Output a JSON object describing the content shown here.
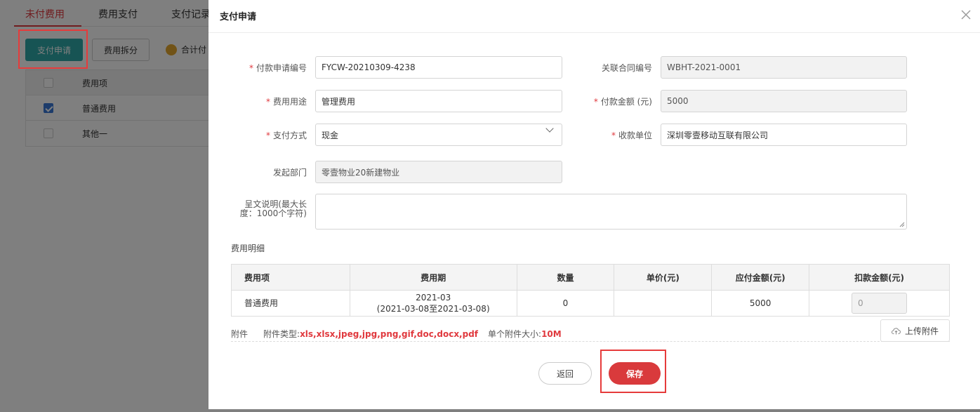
{
  "background": {
    "tabs": [
      {
        "label": "未付费用",
        "active": true
      },
      {
        "label": "费用支付",
        "active": false
      },
      {
        "label": "支付记录",
        "active": false
      }
    ],
    "apply_button": "支付申请",
    "split_button": "费用拆分",
    "total_label": "合计付",
    "table": {
      "header": "费用项",
      "rows": [
        {
          "label": "普通费用",
          "checked": true
        },
        {
          "label": "其他一",
          "checked": false
        }
      ]
    }
  },
  "modal": {
    "title": "支付申请",
    "fields": {
      "payment_no": {
        "label": "付款申请编号",
        "value": "FYCW-20210309-4238",
        "required": true
      },
      "contract_no": {
        "label": "关联合同编号",
        "value": "WBHT-2021-0001",
        "required": false
      },
      "usage": {
        "label": "费用用途",
        "value": "管理费用",
        "required": true
      },
      "amount": {
        "label": "付款金额 (元)",
        "value": "5000",
        "required": true
      },
      "method": {
        "label": "支付方式",
        "value": "现金",
        "required": true
      },
      "payee": {
        "label": "收款单位",
        "value": "深圳零壹移动互联有限公司",
        "required": true
      },
      "dept": {
        "label": "发起部门",
        "value": "零壹物业20新建物业",
        "required": false
      },
      "memo": {
        "label_line1": "呈文说明(最大长",
        "label_line2": "度：1000个字符)",
        "value": ""
      }
    },
    "detail_title": "费用明细",
    "detail_table": {
      "headers": [
        "费用项",
        "费用期",
        "数量",
        "单价(元)",
        "应付金额(元)",
        "扣款金额(元)"
      ],
      "rows": [
        {
          "item": "普通费用",
          "period_line1": "2021-03",
          "period_line2": "(2021-03-08至2021-03-08)",
          "qty": "0",
          "unit_price": "",
          "payable": "5000",
          "deduction": "0"
        }
      ]
    },
    "attachment": {
      "label": "附件",
      "types_label": "附件类型:",
      "types_value": "xls,xlsx,jpeg,jpg,png,gif,doc,docx,pdf",
      "size_label": "单个附件大小:",
      "size_value": "10M",
      "upload_button": "上传附件"
    },
    "back_button": "返回",
    "save_button": "保存"
  },
  "colors": {
    "accent_red": "#d93a3c",
    "teal": "#2ea8a8",
    "highlight": "#e63b3b"
  }
}
